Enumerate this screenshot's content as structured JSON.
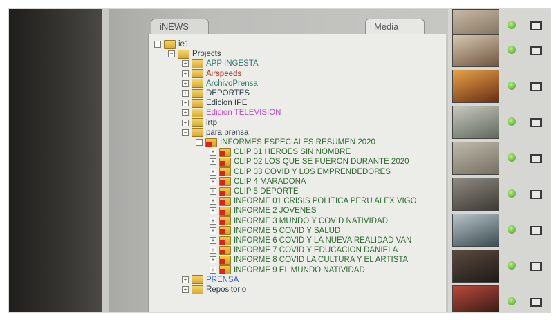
{
  "tabs": {
    "news": "iNEWS",
    "media": "Media"
  },
  "tree": [
    {
      "label": "ie1",
      "color": "dark",
      "level": 0,
      "toggle": "−"
    },
    {
      "label": "Projects",
      "color": "dark",
      "level": 1,
      "toggle": "−"
    },
    {
      "label": "APP INGESTA",
      "color": "teal",
      "level": 2,
      "toggle": "+"
    },
    {
      "label": "Airspeeds",
      "color": "red",
      "level": 2,
      "toggle": "+"
    },
    {
      "label": "ArchivoPrensa",
      "color": "teal",
      "level": 2,
      "toggle": "+"
    },
    {
      "label": "DEPORTES",
      "color": "dark",
      "level": 2,
      "toggle": "+"
    },
    {
      "label": "Edicion IPE",
      "color": "dark",
      "level": 2,
      "toggle": "+"
    },
    {
      "label": "Edicion TELEVISION",
      "color": "pink",
      "level": 2,
      "toggle": "+"
    },
    {
      "label": "irtp",
      "color": "dark",
      "level": 2,
      "toggle": "+"
    },
    {
      "label": "para prensa",
      "color": "dark",
      "level": 2,
      "toggle": "−"
    },
    {
      "label": "INFORMES ESPECIALES RESUMEN 2020",
      "color": "green",
      "level": 3,
      "toggle": "−",
      "red": true
    },
    {
      "label": "CLIP 01 HEROES SIN NOMBRE",
      "color": "green",
      "level": 4,
      "toggle": "+",
      "red": true
    },
    {
      "label": "CLIP 02 LOS QUE SE FUERON DURANTE 2020",
      "color": "green",
      "level": 4,
      "toggle": "+",
      "red": true
    },
    {
      "label": "CLIP 03 COVID Y LOS EMPRENDEDORES",
      "color": "green",
      "level": 4,
      "toggle": "+",
      "red": true
    },
    {
      "label": "CLIP 4 MARADONA",
      "color": "green",
      "level": 4,
      "toggle": "+",
      "red": true
    },
    {
      "label": "CLIP 5 DEPORTE",
      "color": "green",
      "level": 4,
      "toggle": "+",
      "red": true
    },
    {
      "label": "INFORME 01 CRISIS POLITICA PERU ALEX VIGO",
      "color": "green",
      "level": 4,
      "toggle": "+",
      "red": true
    },
    {
      "label": "INFORME 2 JOVENES",
      "color": "green",
      "level": 4,
      "toggle": "+",
      "red": true
    },
    {
      "label": "INFORME 3 MUNDO Y COVID NATIVIDAD",
      "color": "green",
      "level": 4,
      "toggle": "+",
      "red": true
    },
    {
      "label": "INFORME 5 COVID Y SALUD",
      "color": "green",
      "level": 4,
      "toggle": "+",
      "red": true
    },
    {
      "label": "INFORME 6 COVID Y LA NUEVA REALIDAD VAN",
      "color": "green",
      "level": 4,
      "toggle": "+",
      "red": true
    },
    {
      "label": "INFORME 7 COVID Y EDUCACION DANIELA",
      "color": "green",
      "level": 4,
      "toggle": "+",
      "red": true
    },
    {
      "label": "INFORME 8 COVID LA CULTURA Y EL ARTISTA",
      "color": "green",
      "level": 4,
      "toggle": "+",
      "red": true
    },
    {
      "label": "INFORME 9 EL MUNDO NATIVIDAD",
      "color": "green",
      "level": 4,
      "toggle": "+",
      "red": true
    },
    {
      "label": "PRENSA",
      "color": "blue",
      "level": 2,
      "toggle": "+"
    },
    {
      "label": "Repositorio",
      "color": "dark",
      "level": 2,
      "toggle": "+"
    }
  ],
  "thumbnails": [
    {
      "scene": "studio-scene",
      "colors": [
        "#c9b9a4",
        "#7a6b5a"
      ]
    },
    {
      "scene": "person-portrait",
      "colors": [
        "#d8c9b2",
        "#6f5540"
      ]
    },
    {
      "scene": "fire-scene",
      "colors": [
        "#e6a048",
        "#6a2e14"
      ]
    },
    {
      "scene": "crowd-outdoor",
      "colors": [
        "#c9c6bf",
        "#5e6a5c"
      ]
    },
    {
      "scene": "landscape-scene",
      "colors": [
        "#bfb9ac",
        "#75705f"
      ]
    },
    {
      "scene": "crowd-street",
      "colors": [
        "#8f8a80",
        "#3d3a35"
      ]
    },
    {
      "scene": "hospital-scene",
      "colors": [
        "#b7c4c9",
        "#3b4c52"
      ]
    },
    {
      "scene": "dark-room",
      "colors": [
        "#5b4a3e",
        "#1e1a17"
      ]
    },
    {
      "scene": "red-scene",
      "colors": [
        "#b84a3a",
        "#2a1512"
      ]
    }
  ],
  "colors": {
    "dark": "#2f3f49",
    "green": "#2c6b2f",
    "red": "#b23020",
    "teal": "#2d7a70",
    "pink": "#c04ac8",
    "blue": "#3b5fd8",
    "status_green": "#3f9c2a"
  }
}
